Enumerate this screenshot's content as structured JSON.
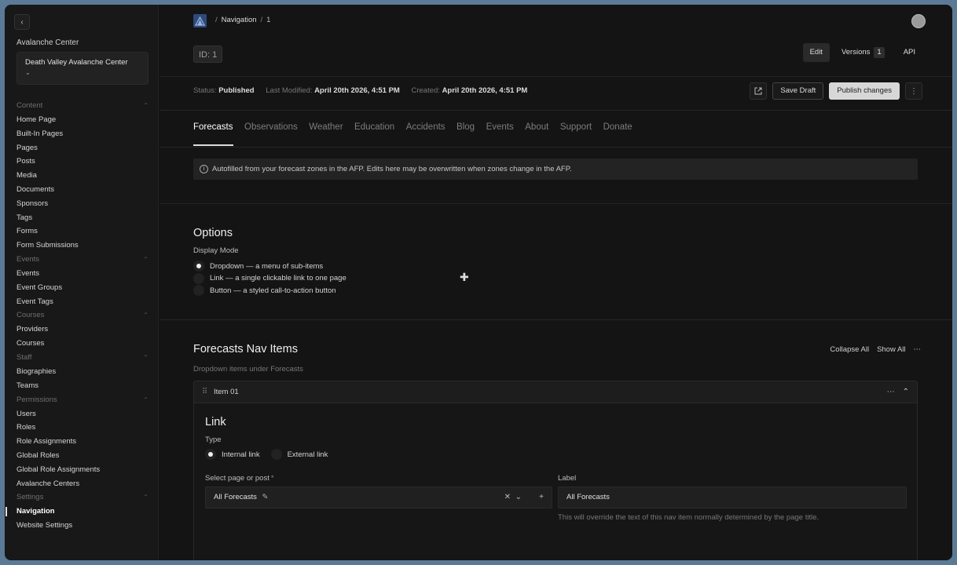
{
  "sidebar": {
    "back_icon": "chevron-left-icon",
    "center_label": "Avalanche Center",
    "center_value": "Death Valley Avalanche Center",
    "groups": [
      {
        "label": "Content",
        "items": [
          "Home Page",
          "Built-In Pages",
          "Pages",
          "Posts",
          "Media",
          "Documents",
          "Sponsors",
          "Tags",
          "Forms",
          "Form Submissions"
        ]
      },
      {
        "label": "Events",
        "items": [
          "Events",
          "Event Groups",
          "Event Tags"
        ]
      },
      {
        "label": "Courses",
        "items": [
          "Providers",
          "Courses"
        ]
      },
      {
        "label": "Staff",
        "items": [
          "Biographies",
          "Teams"
        ]
      },
      {
        "label": "Permissions",
        "items": [
          "Users",
          "Roles",
          "Role Assignments",
          "Global Roles",
          "Global Role Assignments",
          "Avalanche Centers"
        ]
      },
      {
        "label": "Settings",
        "items": [
          "Navigation",
          "Website Settings"
        ]
      }
    ],
    "active_item": "Navigation"
  },
  "header": {
    "breadcrumb": {
      "section": "Navigation",
      "doc": "1"
    },
    "id_badge": "ID: 1",
    "tabs": {
      "edit": "Edit",
      "versions": "Versions",
      "versions_count": "1",
      "api": "API"
    },
    "status_label": "Status:",
    "status_value": "Published",
    "modified_label": "Last Modified:",
    "modified_value": "April 20th 2026, 4:51 PM",
    "created_label": "Created:",
    "created_value": "April 20th 2026, 4:51 PM",
    "save_draft": "Save Draft",
    "publish": "Publish changes"
  },
  "doc_tabs": [
    "Forecasts",
    "Observations",
    "Weather",
    "Education",
    "Accidents",
    "Blog",
    "Events",
    "About",
    "Support",
    "Donate"
  ],
  "active_doc_tab": "Forecasts",
  "notice": "Autofilled from your forecast zones in the AFP. Edits here may be overwritten when zones change in the AFP.",
  "options": {
    "title": "Options",
    "display_mode_label": "Display Mode",
    "modes": [
      {
        "label": "Dropdown — a menu of sub-items",
        "selected": true
      },
      {
        "label": "Link — a single clickable link to one page",
        "selected": false
      },
      {
        "label": "Button — a styled call-to-action button",
        "selected": false
      }
    ]
  },
  "nav_items": {
    "title": "Forecasts Nav Items",
    "subtitle": "Dropdown items under Forecasts",
    "collapse_all": "Collapse All",
    "show_all": "Show All",
    "item": {
      "name": "Item 01",
      "link_title": "Link",
      "type_label": "Type",
      "type_internal": "Internal link",
      "type_external": "External link",
      "select_label": "Select page or post",
      "required_mark": "*",
      "select_value": "All Forecasts",
      "label_label": "Label",
      "label_value": "All Forecasts",
      "label_helper": "This will override the text of this nav item normally determined by the page title."
    }
  }
}
